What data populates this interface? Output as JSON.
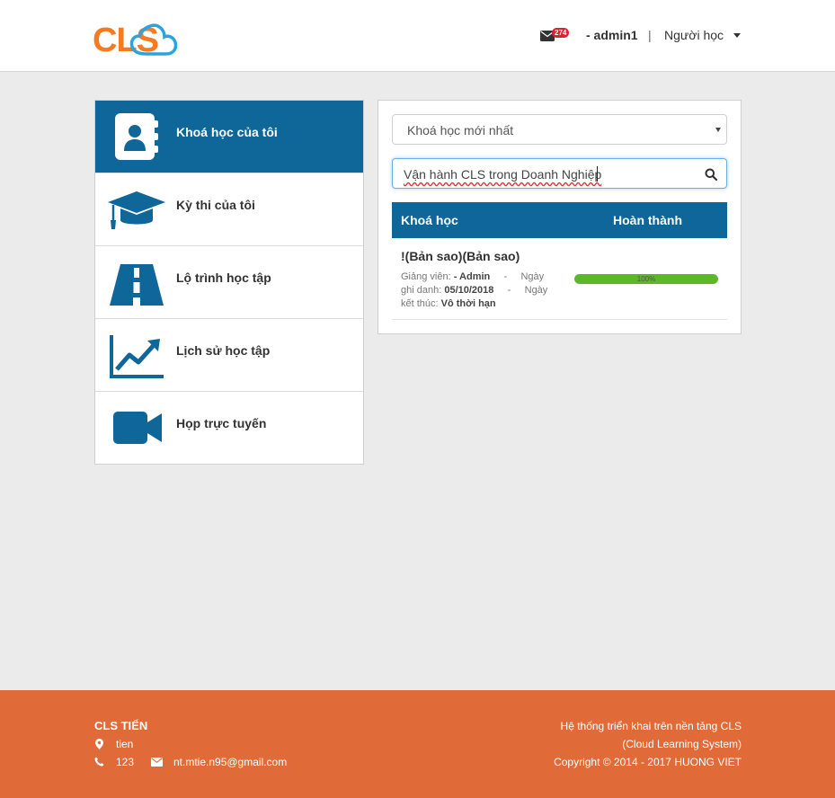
{
  "header": {
    "logo_text": "CLS",
    "mail_badge": "274",
    "username": "- admin1",
    "separator": "|",
    "role": "Người học"
  },
  "sidebar": {
    "items": [
      {
        "label": "Khoá học của tôi",
        "icon": "contact-book-icon",
        "active": true
      },
      {
        "label": "Kỳ thi của tôi",
        "icon": "graduation-cap-icon",
        "active": false
      },
      {
        "label": "Lộ trình học tập",
        "icon": "road-icon",
        "active": false
      },
      {
        "label": "Lịch sử học tập",
        "icon": "line-chart-icon",
        "active": false
      },
      {
        "label": "Họp trực tuyến",
        "icon": "video-camera-icon",
        "active": false
      }
    ]
  },
  "main": {
    "filter_select": "Khoá học mới nhất",
    "search_value": "Vận hành CLS trong Doanh Nghiệp",
    "table": {
      "headers": [
        "Khoá học",
        "Hoàn thành"
      ],
      "rows": [
        {
          "title": "!(Bản sao)(Bản sao)",
          "instructor_label": "Giảng viên:",
          "instructor": "- Admin",
          "dash1": "-",
          "enroll_label": "Ngày ghi danh:",
          "enroll_date": "05/10/2018",
          "dash2": "-",
          "end_label": "Ngày kết thúc:",
          "end_value": "Vô thời hạn",
          "progress": 100,
          "progress_text": "100%"
        }
      ]
    }
  },
  "footer": {
    "company": "CLS TIẾN",
    "address": "tien",
    "phone": "123",
    "email": "nt.mtie.n95@gmail.com",
    "right_line1": "Hệ thống triển khai trên nền tảng CLS",
    "right_line2": "(Cloud Learning System)",
    "right_line3": "Copyright © 2014 - 2017 HUONG VIET"
  },
  "colors": {
    "brand_blue": "#0e6699",
    "brand_orange": "#f47b20",
    "footer_bg": "#e06b38",
    "progress_green": "#5cb82a",
    "badge_red": "#d9232d"
  }
}
